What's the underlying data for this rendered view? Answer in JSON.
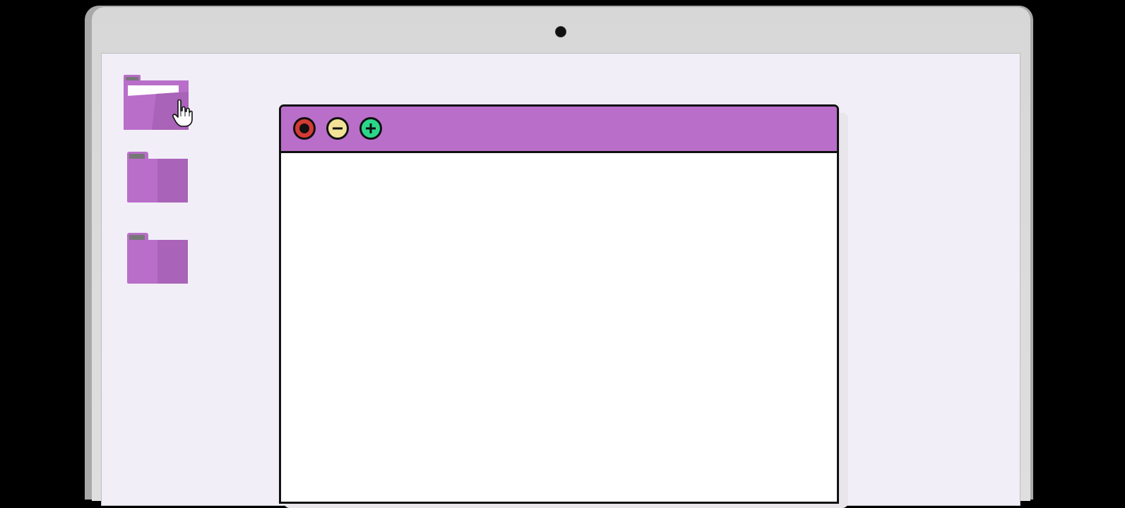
{
  "colors": {
    "folder": "#b96ec9",
    "folder_shade": "#a963b8",
    "folder_tab": "#777777",
    "titlebar": "#b96ec9",
    "close_button": "#d43b34",
    "minimize_button": "#f3e297",
    "maximize_button": "#2bd68b",
    "screen_background": "#f1eef7"
  },
  "desktop": {
    "folders": [
      {
        "state": "open",
        "icon": "folder-open-icon"
      },
      {
        "state": "closed",
        "icon": "folder-icon"
      },
      {
        "state": "closed",
        "icon": "folder-icon"
      }
    ],
    "cursor": "hand-pointer-icon"
  },
  "window": {
    "buttons": [
      {
        "role": "close",
        "icon": "close-icon"
      },
      {
        "role": "minimize",
        "icon": "minus-icon"
      },
      {
        "role": "maximize",
        "icon": "plus-icon"
      }
    ]
  }
}
